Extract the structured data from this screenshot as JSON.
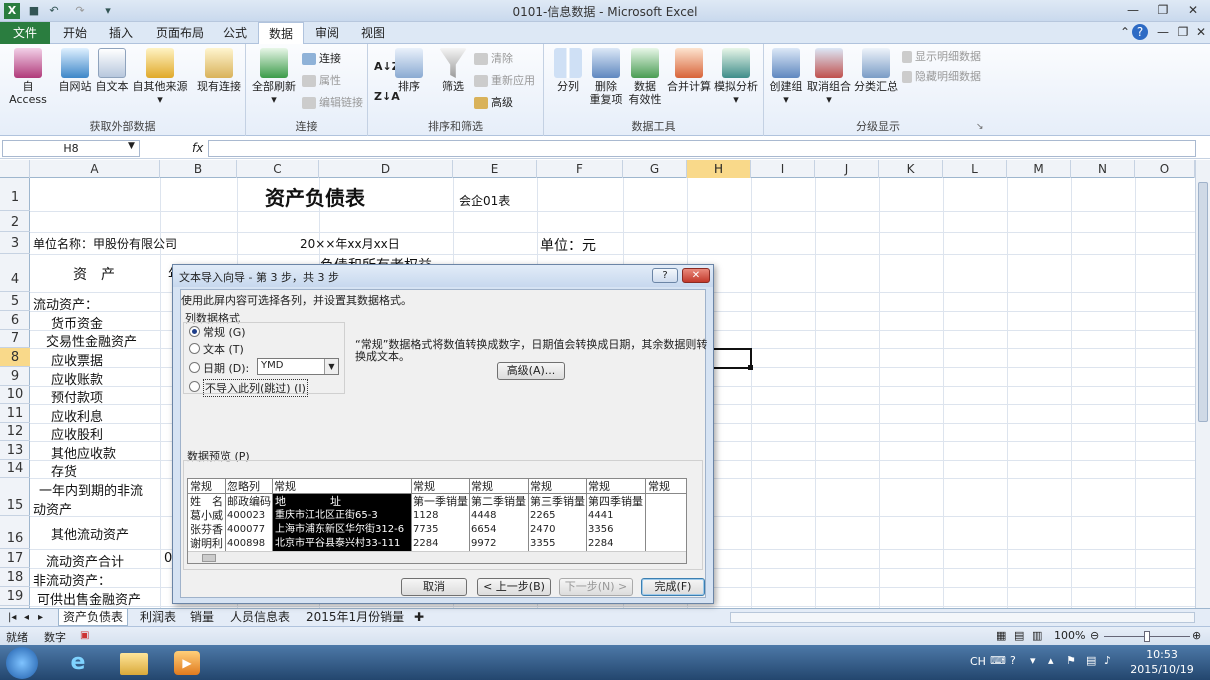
{
  "window": {
    "title": "0101-信息数据 - Microsoft Excel"
  },
  "ribbon_tabs": [
    "文件",
    "开始",
    "插入",
    "页面布局",
    "公式",
    "数据",
    "审阅",
    "视图"
  ],
  "ribbon": {
    "ext": {
      "label": "获取外部数据",
      "items": [
        "自 Access",
        "自网站",
        "自文本",
        "自其他来源",
        "现有连接"
      ]
    },
    "conn": {
      "label": "连接",
      "refresh": "全部刷新",
      "small": [
        "连接",
        "属性",
        "编辑链接"
      ]
    },
    "sort": {
      "label": "排序和筛选",
      "sort": "排序",
      "filter": "筛选",
      "small": [
        "清除",
        "重新应用",
        "高级"
      ]
    },
    "tools": {
      "label": "数据工具",
      "items": [
        "分列",
        "删除\n重复项",
        "数据\n有效性",
        "合并计算",
        "模拟分析"
      ]
    },
    "outline": {
      "label": "分级显示",
      "items": [
        "创建组",
        "取消组合",
        "分类汇总"
      ],
      "small": [
        "显示明细数据",
        "隐藏明细数据"
      ]
    }
  },
  "formula": {
    "namebox": "H8",
    "fx": "fx"
  },
  "columns": [
    "A",
    "B",
    "C",
    "D",
    "E",
    "F",
    "G",
    "H",
    "I",
    "J",
    "K",
    "L",
    "M",
    "N",
    "O"
  ],
  "rows": [
    "1",
    "2",
    "3",
    "4",
    "5",
    "6",
    "7",
    "8",
    "9",
    "10",
    "11",
    "12",
    "13",
    "14",
    "15",
    "16",
    "17",
    "18",
    "19"
  ],
  "cells": {
    "title": "资产负债表",
    "form": "会企01表",
    "company": "单位名称：甲股份有限公司",
    "date": "20××年xx月xx日",
    "unit": "单位：元",
    "asset_head": "资　产",
    "liab_head": "负债和所有者权益",
    "b4": "年",
    "b17": "0",
    "a5": "流动资产：",
    "a6": "货币资金",
    "a7": "交易性金融资产",
    "a8": "应收票据",
    "a9": "应收账款",
    "a10": "预付款项",
    "a11": "应收利息",
    "a12": "应收股利",
    "a13": "其他应收款",
    "a14": "存货",
    "a15a": "一年内到期的非流",
    "a15b": "动资产",
    "a16": "其他流动资产",
    "a17": "流动资产合计",
    "a18": "非流动资产：",
    "a19": "可供出售金融资产"
  },
  "sheets": [
    "资产负债表",
    "利润表",
    "销量",
    "人员信息表",
    "2015年1月份销量"
  ],
  "status": {
    "mode": "就绪",
    "num": "数字",
    "zoom": "100%"
  },
  "taskbar": {
    "time": "10:53",
    "date": "2015/10/19",
    "lang": "CH"
  },
  "dialog": {
    "title": "文本导入向导 - 第 3 步，共 3 步",
    "instruction": "使用此屏内容可选择各列，并设置其数据格式。",
    "group_label": "列数据格式",
    "options": [
      "常规 (G)",
      "文本 (T)",
      "日期 (D):",
      "不导入此列(跳过) (I)"
    ],
    "selected_option": 0,
    "date_value": "YMD",
    "help_line1": "“常规”数据格式将数值转换成数字，日期值会转换成日期，其余数据则转",
    "help_line2": "换成文本。",
    "advanced": "高级(A)...",
    "preview_label": "数据预览 (P)",
    "preview": {
      "types": [
        "常规",
        "忽略列",
        "常规",
        "常规",
        "常规",
        "常规",
        "常规",
        "常规"
      ],
      "rows": [
        [
          "姓　名",
          "邮政编码",
          "地　　　　址",
          "第一季销量",
          "第二季销量",
          "第三季销量",
          "第四季销量"
        ],
        [
          "葛小威",
          "400023",
          "重庆市江北区正街65-3",
          "1128",
          "4448",
          "2265",
          "4441"
        ],
        [
          "张芬香",
          "400077",
          "上海市浦东新区华尔街312-6",
          "7735",
          "6654",
          "2470",
          "3356"
        ],
        [
          "谢明利",
          "400898",
          "北京市平谷县泰兴村33-111",
          "2284",
          "9972",
          "3355",
          "2284"
        ]
      ]
    },
    "buttons": {
      "cancel": "取消",
      "back": "< 上一步(B)",
      "next": "下一步(N) >",
      "finish": "完成(F)"
    }
  },
  "colors": {
    "accent": "#2a7d3f",
    "selected_header": "#f9d98a",
    "dialog_bg": "#f0f0f0"
  }
}
